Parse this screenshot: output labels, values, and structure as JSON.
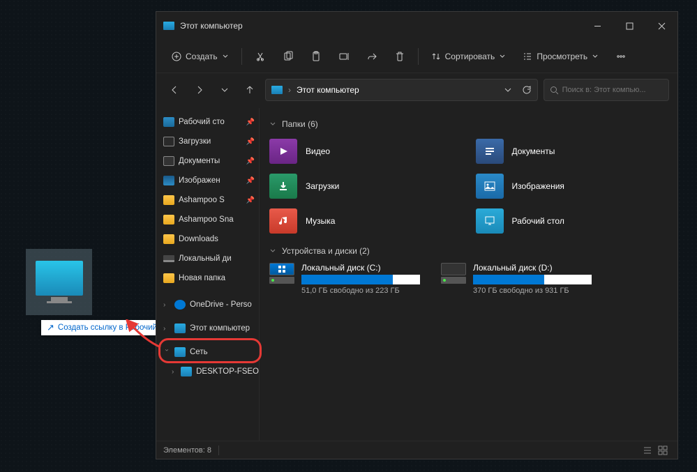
{
  "window": {
    "title": "Этот компьютер"
  },
  "toolbar": {
    "new": "Создать",
    "sort": "Сортировать",
    "view": "Просмотреть"
  },
  "nav": {
    "breadcrumb": "Этот компьютер",
    "search_placeholder": "Поиск в: Этот компью..."
  },
  "sidebar": {
    "items": [
      {
        "label": "Рабочий сто",
        "pin": true,
        "cls": "desktop"
      },
      {
        "label": "Загрузки",
        "pin": true,
        "cls": "download"
      },
      {
        "label": "Документы",
        "pin": true,
        "cls": "doc"
      },
      {
        "label": "Изображен",
        "pin": true,
        "cls": "img"
      },
      {
        "label": "Ashampoo S",
        "pin": true,
        "cls": "folder"
      },
      {
        "label": "Ashampoo Sna",
        "cls": "folder"
      },
      {
        "label": "Downloads",
        "cls": "folder"
      },
      {
        "label": "Локальный ди",
        "cls": "disk"
      },
      {
        "label": "Новая папка",
        "cls": "folder"
      }
    ],
    "onedrive": "OneDrive - Perso",
    "this_pc": "Этот компьютер",
    "network": "Сеть",
    "desktop_node": "DESKTOP-FSEO"
  },
  "main": {
    "folders_header": "Папки (6)",
    "drives_header": "Устройства и диски (2)",
    "folders": [
      {
        "label": "Видео",
        "cls": "video"
      },
      {
        "label": "Документы",
        "cls": "docs"
      },
      {
        "label": "Загрузки",
        "cls": "dl"
      },
      {
        "label": "Изображения",
        "cls": "imgs"
      },
      {
        "label": "Музыка",
        "cls": "music"
      },
      {
        "label": "Рабочий стол",
        "cls": "desk"
      }
    ],
    "drives": [
      {
        "name": "Локальный диск (C:)",
        "info": "51,0 ГБ свободно из 223 ГБ",
        "fill": 77,
        "win": true
      },
      {
        "name": "Локальный диск (D:)",
        "info": "370 ГБ свободно из 931 ГБ",
        "fill": 60,
        "win": false
      }
    ]
  },
  "status": {
    "count": "Элементов: 8"
  },
  "tooltip": {
    "text": "Создать ссылку в Рабочий стол"
  }
}
